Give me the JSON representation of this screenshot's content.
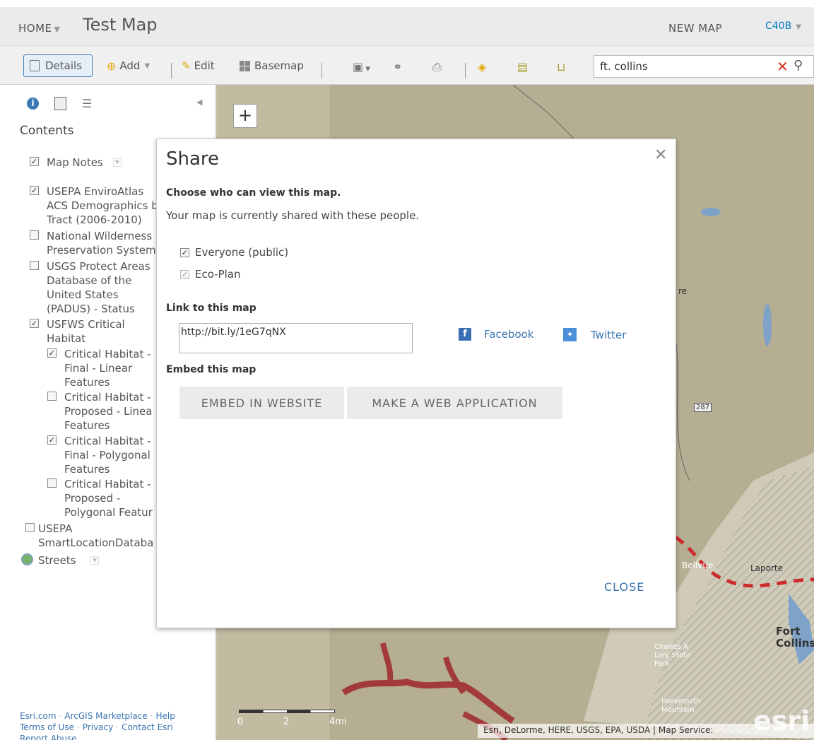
{
  "header": {
    "home_label": "HOME",
    "map_title": "Test Map",
    "new_map_label": "NEW MAP",
    "user_label": "C40B"
  },
  "toolbar": {
    "details_label": "Details",
    "add_label": "Add",
    "edit_label": "Edit",
    "basemap_label": "Basemap",
    "search_value": "ft. collins",
    "icons": [
      "save-icon",
      "link-icon",
      "print-icon",
      "directions-icon",
      "measure-icon",
      "bookmark-icon"
    ]
  },
  "sidebar": {
    "contents_title": "Contents",
    "layers": [
      {
        "label": "Map Notes",
        "checked": true
      },
      {
        "label": "USEPA EnviroAtlas\nACS Demographics b\nTract (2006-2010)",
        "checked": true
      },
      {
        "label": "National Wilderness\nPreservation System",
        "checked": false
      },
      {
        "label": "USGS Protect Areas\nDatabase of the\nUnited States\n(PADUS) - Status",
        "checked": false
      },
      {
        "label": "USFWS Critical\nHabitat",
        "checked": true
      },
      {
        "label": "Critical Habitat -\nFinal - Linear\nFeatures",
        "checked": true
      },
      {
        "label": "Critical Habitat -\nProposed - Linea\nFeatures",
        "checked": false
      },
      {
        "label": "Critical Habitat -\nFinal - Polygonal\nFeatures",
        "checked": true
      },
      {
        "label": "Critical Habitat -\nProposed -\nPolygonal Featur",
        "checked": false
      },
      {
        "label": "USEPA\nSmartLocationDataba",
        "checked": false
      },
      {
        "label": "Streets",
        "checked": true
      }
    ],
    "footer_links": [
      "Esri.com",
      "ArcGIS Marketplace",
      "Help",
      "Terms of Use",
      "Privacy",
      "Contact Esri",
      "Report Abuse"
    ]
  },
  "map": {
    "scale_labels": [
      "0",
      "2",
      "4mi"
    ],
    "attribution": "Esri, DeLorme, HERE, USGS, EPA, USDA | Map Service:",
    "esri_logo": "esri",
    "places": [
      "Fort Collins",
      "Laporte",
      "Bellvue",
      "Charles A Lory State Park",
      "Horsetooth Mountain",
      "287",
      "re"
    ]
  },
  "dialog": {
    "title": "Share",
    "who_heading": "Choose who can view this map.",
    "who_desc": "Your map is currently shared with these people.",
    "options": [
      {
        "label": "Everyone (public)",
        "checked": true
      },
      {
        "label": "Eco-Plan",
        "checked": true
      }
    ],
    "link_heading": "Link to this map",
    "link_value": "http://bit.ly/1eG7qNX",
    "facebook_label": "Facebook",
    "twitter_label": "Twitter",
    "embed_heading": "Embed this map",
    "embed_website_label": "EMBED IN WEBSITE",
    "make_app_label": "MAKE A WEB APPLICATION",
    "close_label": "CLOSE"
  },
  "colors": {
    "accent": "#0079c1",
    "critical_habitat": "#a33a3a",
    "map_base": "#b5ae92"
  }
}
